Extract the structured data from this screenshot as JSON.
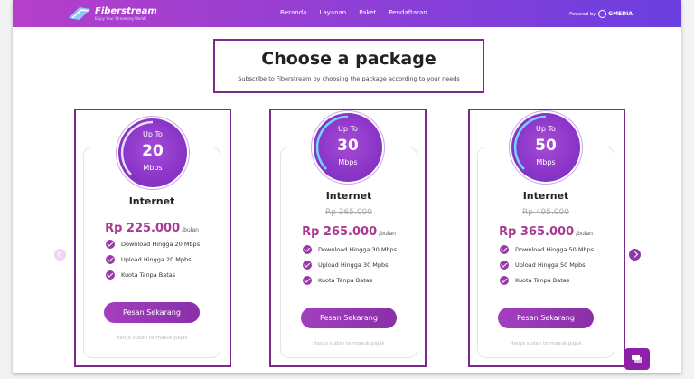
{
  "header": {
    "logo_name": "Fiberstream",
    "logo_tagline": "Enjoy Your Streaming World!",
    "nav": [
      "Beranda",
      "Layanan",
      "Paket",
      "Pendaftaran"
    ],
    "powered_label": "Powered by",
    "powered_brand": "GMEDIA"
  },
  "hero": {
    "title": "Choose a package",
    "subtitle": "Subscribe to Fiberstream by choosing the package according to your needs"
  },
  "packages": [
    {
      "up_to": "Up To",
      "speed": "20",
      "unit": "Mbps",
      "title": "Internet",
      "old_price": "",
      "price": "Rp 225.000",
      "per": "/bulan",
      "features": [
        "Download Hingga 20 Mbps",
        "Upload Hingga 20 Mpbs",
        "Kuota Tanpa Batas"
      ],
      "button": "Pesan Sekarang",
      "note": "Harga sudah termasuk pajak"
    },
    {
      "up_to": "Up To",
      "speed": "30",
      "unit": "Mbps",
      "title": "Internet",
      "old_price": "Rp 365.000",
      "price": "Rp 265.000",
      "per": "/bulan",
      "features": [
        "Download Hingga 30 Mbps",
        "Upload Hingga 30 Mpbs",
        "Kuota Tanpa Batas"
      ],
      "button": "Pesan Sekarang",
      "note": "Harga sudah termasuk pajak"
    },
    {
      "up_to": "Up To",
      "speed": "50",
      "unit": "Mbps",
      "title": "Internet",
      "old_price": "Rp 495.000",
      "price": "Rp 365.000",
      "per": "/bulan",
      "features": [
        "Download Hingga 50 Mbps",
        "Upload Hingga 50 Mpbs",
        "Kuota Tanpa Batas"
      ],
      "button": "Pesan Sekarang",
      "note": "Harga sudah termasuk pajak"
    }
  ],
  "icons": {
    "carousel_prev": "chevron-left-icon",
    "carousel_next": "chevron-right-icon",
    "chat": "chat-icon",
    "feature": "check-circle-icon"
  },
  "colors": {
    "accent": "#9a3aa8",
    "price": "#a83a93",
    "outline": "#7b2a8c",
    "header_start": "#b53fc9",
    "header_end": "#6b3fe0"
  }
}
